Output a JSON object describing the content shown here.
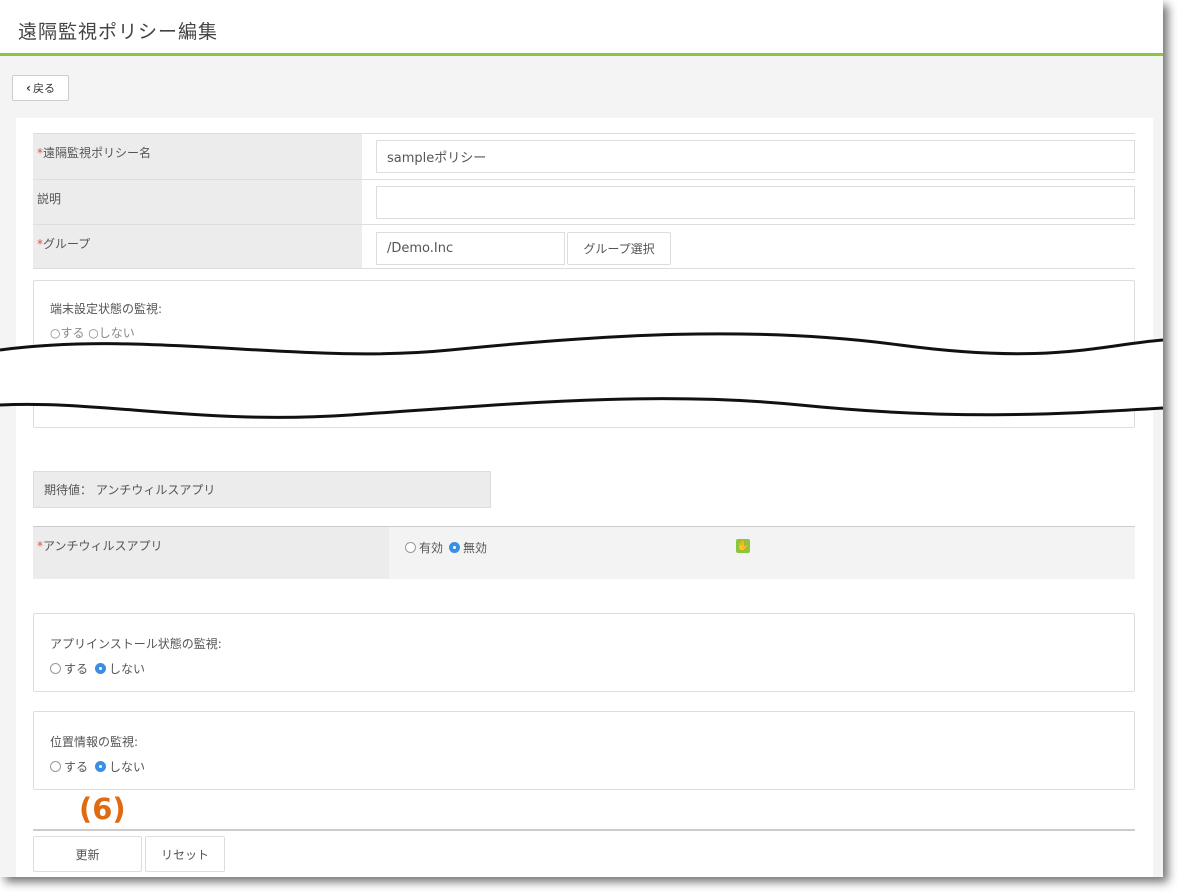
{
  "header": {
    "title": "遠隔監視ポリシー編集"
  },
  "back": {
    "label": "戻る"
  },
  "form": {
    "policy_name": {
      "label": "遠隔監視ポリシー名",
      "required": "*",
      "value": "sampleポリシー"
    },
    "description": {
      "label": "説明",
      "value": ""
    },
    "group": {
      "label": "グループ",
      "required": "*",
      "value": "/Demo.Inc",
      "select_button": "グループ選択"
    }
  },
  "device_settings": {
    "title": "端末設定状態の監視:",
    "partial_radio": "○する ○しない"
  },
  "expected": {
    "label": "期待値： アンチウィルスアプリ"
  },
  "antivirus": {
    "label": "アンチウィルスアプリ",
    "required": "*",
    "option_enabled": "有効",
    "option_disabled": "無効",
    "selected": "無効"
  },
  "app_install": {
    "title": "アプリインストール状態の監視:",
    "option_yes": "する",
    "option_no": "しない",
    "selected": "しない"
  },
  "location": {
    "title": "位置情報の監視:",
    "option_yes": "する",
    "option_no": "しない",
    "selected": "しない"
  },
  "annotation": "(6)",
  "actions": {
    "update": "更新",
    "reset": "リセット"
  },
  "colors": {
    "accent_green": "#8cc63f",
    "radio_blue": "#3a8ee6",
    "required_red": "#d9534f",
    "annotation_orange": "#e06a10"
  }
}
